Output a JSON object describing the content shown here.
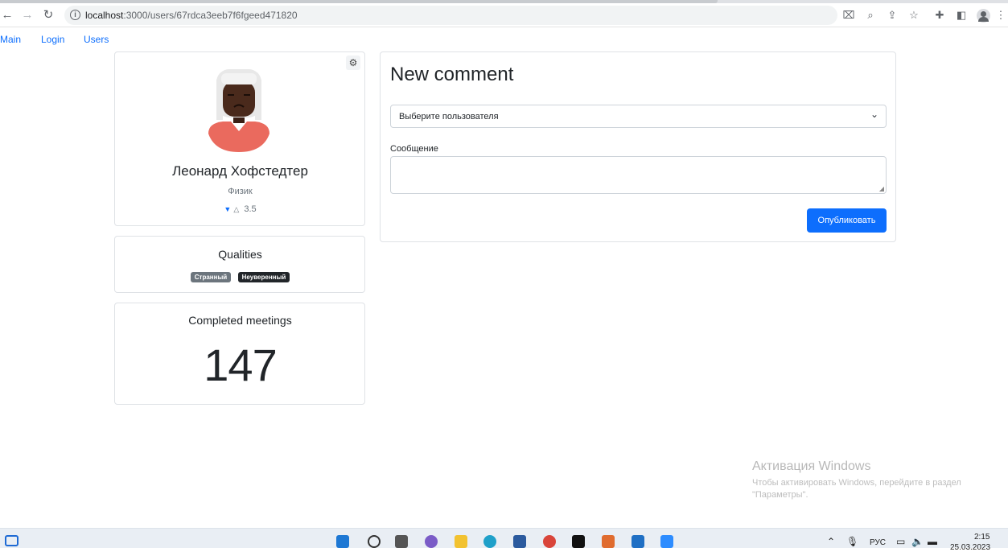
{
  "browser": {
    "url_host": "localhost",
    "url_path": ":3000/users/67rdca3eeb7f6fgeed471820"
  },
  "nav": {
    "main": "Main",
    "login": "Login",
    "users": "Users"
  },
  "profile": {
    "name": "Леонард Хофстедтер",
    "profession": "Физик",
    "rating": "3.5"
  },
  "qualities": {
    "title": "Qualities",
    "badges": [
      {
        "label": "Странный",
        "color": "#6c757d"
      },
      {
        "label": "Неуверенный",
        "color": "#212529"
      }
    ]
  },
  "meetings": {
    "title": "Completed meetings",
    "count": "147"
  },
  "comment_form": {
    "title": "New comment",
    "select_placeholder": "Выберите пользователя",
    "message_label": "Сообщение",
    "submit_label": "Опубликовать"
  },
  "watermark": {
    "title": "Активация Windows",
    "line1": "Чтобы активировать Windows, перейдите в раздел",
    "line2": "\"Параметры\"."
  },
  "taskbar": {
    "lang": "РУС",
    "time": "2:15",
    "date": "25.03.2023"
  },
  "colors": {
    "primary": "#0d6efd",
    "badge_secondary": "#6c757d",
    "badge_dark": "#212529"
  }
}
